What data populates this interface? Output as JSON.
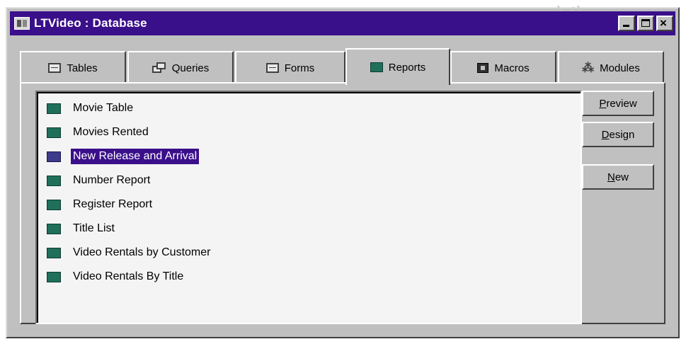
{
  "window": {
    "title": "LTVideo : Database"
  },
  "tabs": [
    {
      "label": "Tables",
      "icon": "table-icon"
    },
    {
      "label": "Queries",
      "icon": "query-icon"
    },
    {
      "label": "Forms",
      "icon": "form-icon"
    },
    {
      "label": "Reports",
      "icon": "report-icon",
      "active": true
    },
    {
      "label": "Macros",
      "icon": "macro-icon"
    },
    {
      "label": "Modules",
      "icon": "module-icon"
    }
  ],
  "reports": [
    {
      "label": "Movie Table"
    },
    {
      "label": "Movies Rented"
    },
    {
      "label": "New Release and Arrival",
      "selected": true
    },
    {
      "label": "Number Report"
    },
    {
      "label": "Register Report"
    },
    {
      "label": "Title List"
    },
    {
      "label": "Video Rentals by Customer"
    },
    {
      "label": "Video Rentals By Title"
    }
  ],
  "buttons": {
    "preview": "Preview",
    "design": "Design",
    "new": "New"
  },
  "colors": {
    "title_bar": "#3a0f8a",
    "selection": "#3a0f8a",
    "report_icon": "#1f6f5a",
    "face": "#c0c0c0"
  }
}
